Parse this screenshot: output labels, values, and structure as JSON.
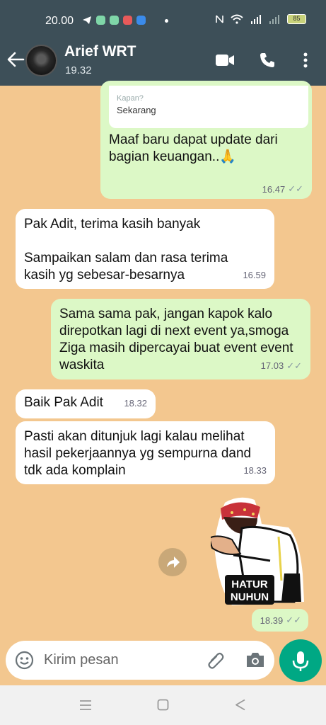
{
  "status": {
    "time": "20.00",
    "battery": "85"
  },
  "header": {
    "contact_name": "Arief WRT",
    "subtitle": "19.32"
  },
  "quoted": {
    "label": "Kapan?",
    "value": "Sekarang"
  },
  "messages": [
    {
      "side": "out",
      "text": "Maaf baru dapat update dari bagian keuangan..🙏",
      "time": "16.47"
    },
    {
      "side": "in",
      "text": "Pak Adit, terima kasih banyak\n\nSampaikan salam dan rasa terima kasih yg sebesar-besarnya",
      "time": "16.59"
    },
    {
      "side": "out",
      "text": "Sama sama pak, jangan kapok kalo direpotkan lagi di next event ya,smoga Ziga masih dipercayai buat event event waskita",
      "time": "17.03"
    },
    {
      "side": "in",
      "text": "Baik Pak Adit",
      "time": "18.32"
    },
    {
      "side": "in",
      "text": "Pasti akan ditunjuk lagi kalau melihat hasil pekerjaannya yg sempurna dand tdk ada komplain",
      "time": "18.33"
    }
  ],
  "sticker": {
    "caption": "HATUR NUHUN",
    "time": "18.39"
  },
  "composer": {
    "placeholder": "Kirim pesan"
  },
  "colors": {
    "header": "#3d4f58",
    "outgoing": "#dcf8c6",
    "incoming": "#ffffff",
    "background": "#f3c78f",
    "accent": "#00a884"
  }
}
